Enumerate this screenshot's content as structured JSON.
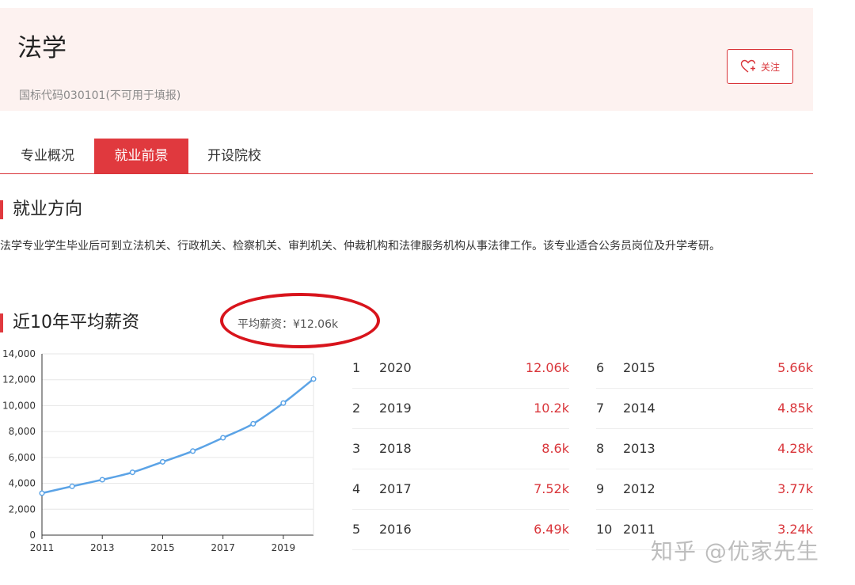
{
  "header": {
    "title": "法学",
    "subtitle": "国标代码030101(不可用于填报)",
    "follow_label": "关注"
  },
  "tabs": [
    {
      "label": "专业概况",
      "active": false
    },
    {
      "label": "就业前景",
      "active": true
    },
    {
      "label": "开设院校",
      "active": false
    }
  ],
  "employment": {
    "title": "就业方向",
    "text": "法学专业学生毕业后可到立法机关、行政机关、检察机关、审判机关、仲裁机构和法律服务机构从事法律工作。该专业适合公务员岗位及升学考研。"
  },
  "salary": {
    "title": "近10年平均薪资",
    "average_label": "平均薪资：¥12.06k"
  },
  "chart_data": {
    "type": "line",
    "x": [
      2011,
      2012,
      2013,
      2014,
      2015,
      2016,
      2017,
      2018,
      2019,
      2020
    ],
    "values": [
      3240,
      3770,
      4280,
      4850,
      5660,
      6490,
      7520,
      8600,
      10200,
      12060
    ],
    "xticks": [
      "2011",
      "2013",
      "2015",
      "2017",
      "2019"
    ],
    "yticks": [
      "0",
      "2,000",
      "4,000",
      "6,000",
      "8,000",
      "10,000",
      "12,000",
      "14,000"
    ],
    "ylim": [
      0,
      14000
    ],
    "grid": true,
    "color": "#5ba3e6"
  },
  "ranking": [
    {
      "rank": "1",
      "year": "2020",
      "salary": "12.06k"
    },
    {
      "rank": "2",
      "year": "2019",
      "salary": "10.2k"
    },
    {
      "rank": "3",
      "year": "2018",
      "salary": "8.6k"
    },
    {
      "rank": "4",
      "year": "2017",
      "salary": "7.52k"
    },
    {
      "rank": "5",
      "year": "2016",
      "salary": "6.49k"
    },
    {
      "rank": "6",
      "year": "2015",
      "salary": "5.66k"
    },
    {
      "rank": "7",
      "year": "2014",
      "salary": "4.85k"
    },
    {
      "rank": "8",
      "year": "2013",
      "salary": "4.28k"
    },
    {
      "rank": "9",
      "year": "2012",
      "salary": "3.77k"
    },
    {
      "rank": "10",
      "year": "2011",
      "salary": "3.24k"
    }
  ],
  "watermark": "知乎 @优家先生",
  "colors": {
    "accent": "#e0393e",
    "header_bg": "#fdf2f0",
    "line": "#5ba3e6"
  }
}
